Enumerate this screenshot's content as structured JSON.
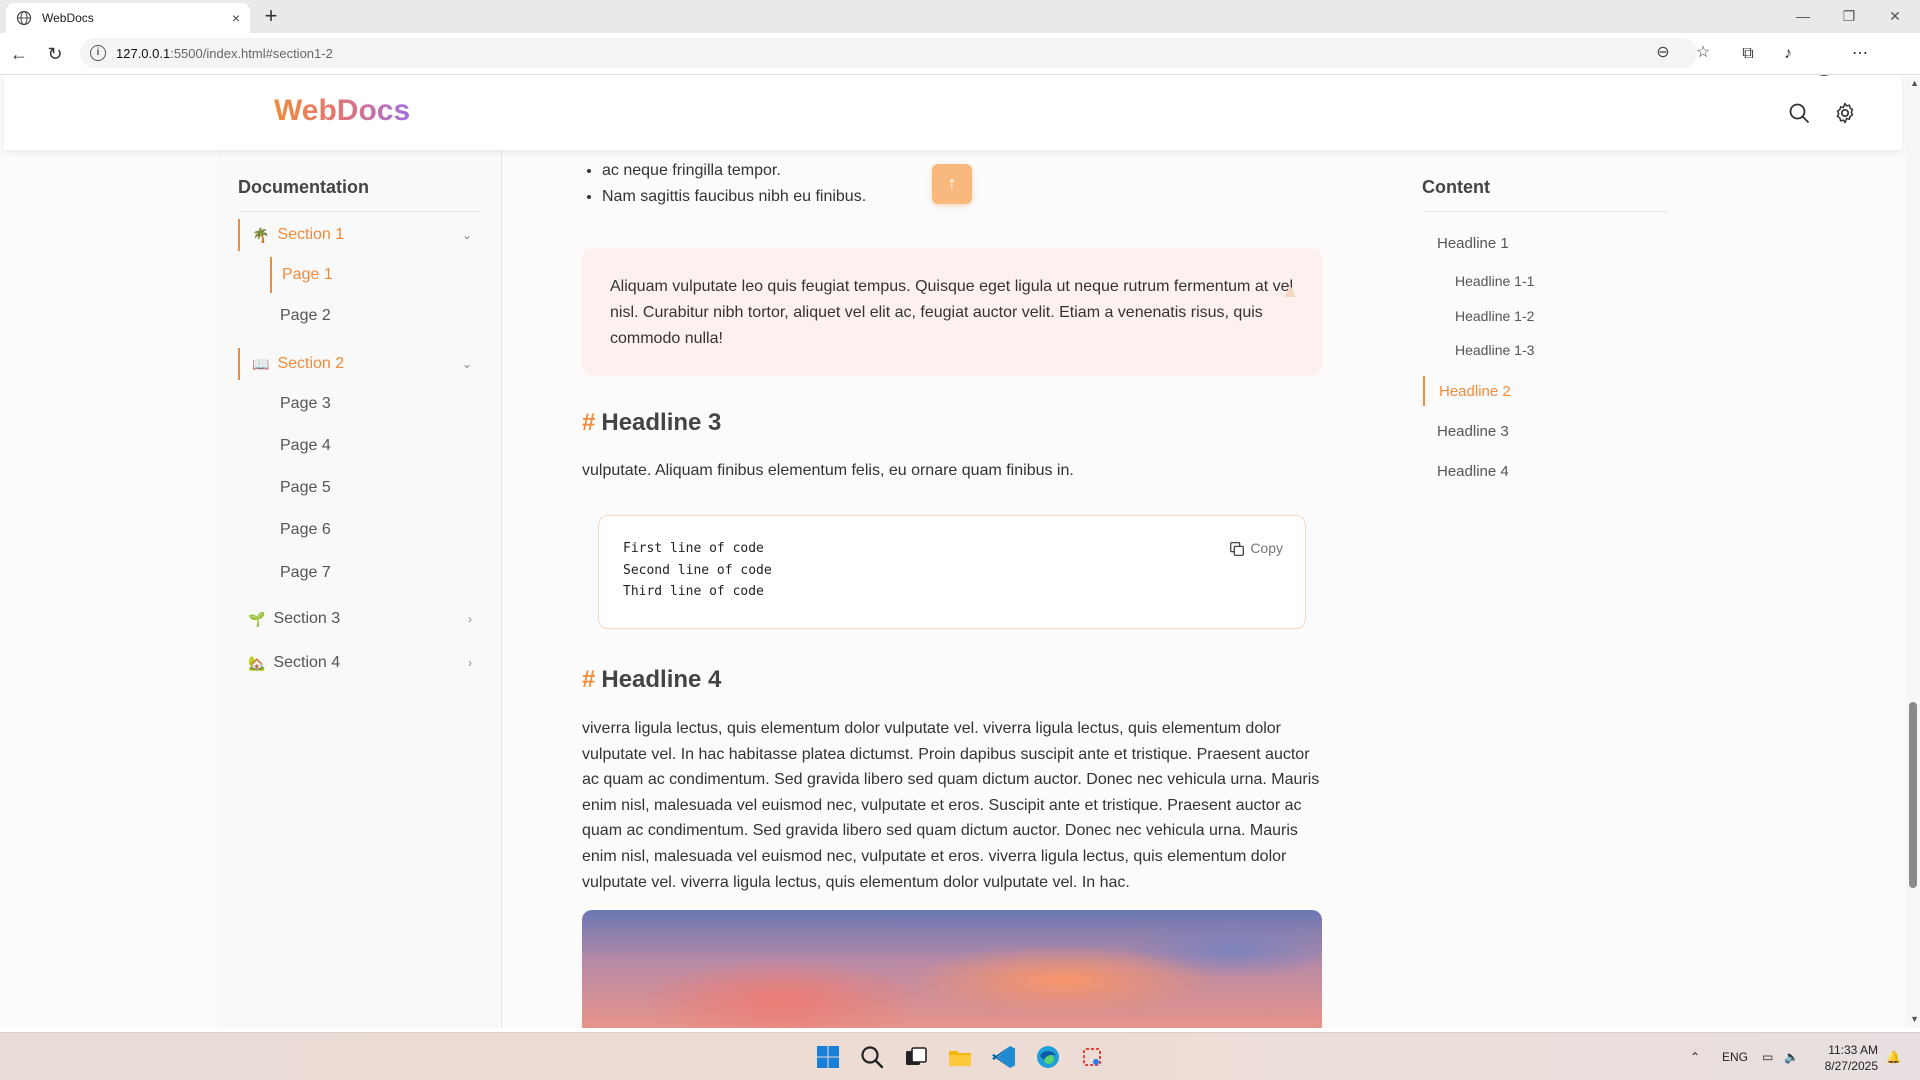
{
  "browser": {
    "tab_title": "WebDocs",
    "tab_close": "×",
    "new_tab": "+",
    "url_host": "127.0.0.1",
    "url_rest": ":5500/index.html#section1-2"
  },
  "site": {
    "logo": "WebDocs"
  },
  "sidebar": {
    "title": "Documentation",
    "sections": [
      {
        "emoji": "🌴",
        "label": "Section 1",
        "state": "expanded"
      },
      {
        "emoji": "📖",
        "label": "Section 2",
        "state": "expanded"
      },
      {
        "emoji": "🌱",
        "label": "Section 3",
        "state": "collapsed"
      },
      {
        "emoji": "🏡",
        "label": "Section 4",
        "state": "collapsed"
      }
    ],
    "pages": [
      "Page 1",
      "Page 2",
      "Page 3",
      "Page 4",
      "Page 5",
      "Page 6",
      "Page 7"
    ],
    "active_page": "Page 1"
  },
  "main": {
    "list_items": [
      "ac neque fringilla tempor.",
      "Nam sagittis faucibus nibh eu finibus."
    ],
    "back_to_top": "↑",
    "callout_text": "Aliquam vulputate leo quis feugiat tempus. Quisque eget ligula ut neque rutrum fermentum at vel nisl. Curabitur nibh tortor, aliquet vel elit ac, feugiat auctor velit. Etiam a venenatis risus, quis commodo nulla!",
    "headline3": "Headline 3",
    "headline3_text": "vulputate. Aliquam finibus elementum felis, eu ornare quam finibus in.",
    "code_lines": [
      "First line of code",
      "Second line of code",
      "Third line of code"
    ],
    "copy_label": "Copy",
    "headline4": "Headline 4",
    "headline4_text": "viverra ligula lectus, quis elementum dolor vulputate vel. viverra ligula lectus, quis elementum dolor vulputate vel. In hac habitasse platea dictumst. Proin dapibus suscipit ante et tristique. Praesent auctor ac quam ac condimentum. Sed gravida libero sed quam dictum auctor. Donec nec vehicula urna. Mauris enim nisl, malesuada vel euismod nec, vulputate et eros. Suscipit ante et tristique. Praesent auctor ac quam ac condimentum. Sed gravida libero sed quam dictum auctor. Donec nec vehicula urna. Mauris enim nisl, malesuada vel euismod nec, vulputate et eros. viverra ligula lectus, quis elementum dolor vulputate vel. viverra ligula lectus, quis elementum dolor vulputate vel. In hac.",
    "hash": "#"
  },
  "toc": {
    "title": "Content",
    "items": [
      "Headline 1",
      "Headline 1-1",
      "Headline 1-2",
      "Headline 1-3",
      "Headline 2",
      "Headline 3",
      "Headline 4"
    ],
    "active": "Headline 2"
  },
  "taskbar": {
    "language": "ENG",
    "time": "11:33 AM",
    "date": "8/27/2025"
  },
  "colors": {
    "accent": "#f28b3b",
    "callout_bg": "#fdf1f0"
  }
}
